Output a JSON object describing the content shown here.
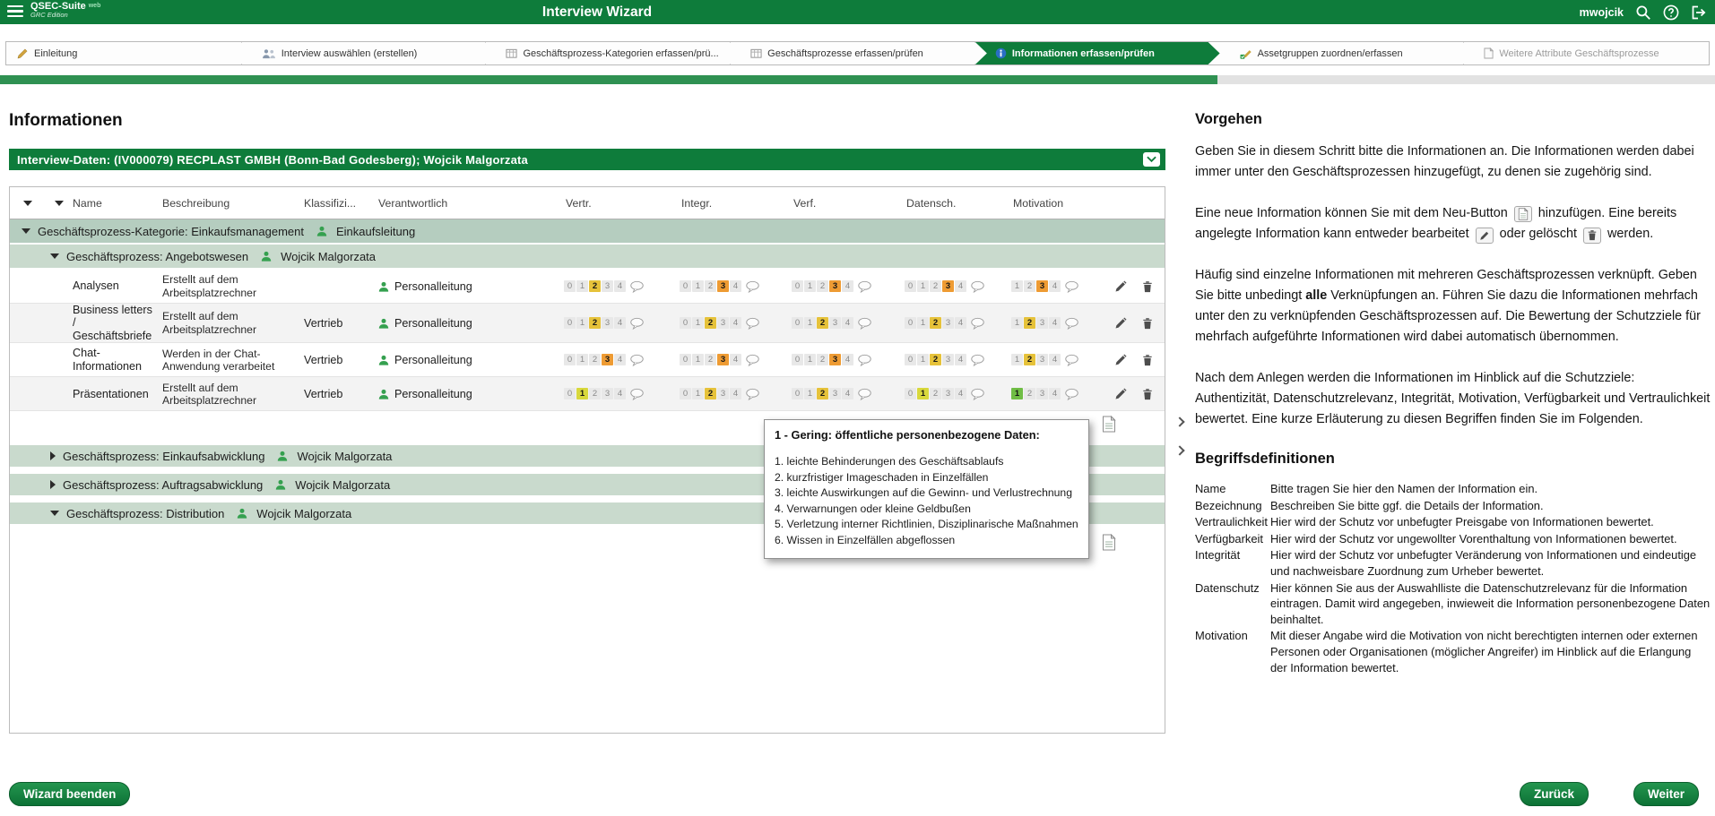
{
  "topbar": {
    "logo_title": "QSEC-Suite",
    "logo_badge": "web",
    "logo_subtitle": "GRC Edition",
    "title": "Interview Wizard",
    "username": "mwojcik"
  },
  "wizard": {
    "steps": [
      {
        "label": "Einleitung"
      },
      {
        "label": "Interview auswählen (erstellen)"
      },
      {
        "label": "Geschäftsprozess-Kategorien erfassen/prü..."
      },
      {
        "label": "Geschäftsprozesse erfassen/prüfen"
      },
      {
        "label": "Informationen erfassen/prüfen"
      },
      {
        "label": "Assetgruppen zuordnen/erfassen"
      },
      {
        "label": "Weitere Attribute Geschäftsprozesse"
      }
    ],
    "progress_percent": 71
  },
  "main": {
    "heading": "Informationen",
    "interview_bar": "Interview-Daten: (IV000079) RECPLAST GMBH (Bonn-Bad Godesberg); Wojcik Malgorzata",
    "columns": [
      "Name",
      "Beschreibung",
      "Klassifizi...",
      "Verantwortlich",
      "Vertr.",
      "Integr.",
      "Verf.",
      "Datensch.",
      "Motivation"
    ],
    "category": {
      "label": "Geschäftsprozess-Kategorie: Einkaufsmanagement",
      "owner": "Einkaufsleitung"
    },
    "process": {
      "label": "Geschäftsprozess: Angebotswesen",
      "owner": "Wojcik Malgorzata"
    },
    "collapsed": [
      {
        "label": "Geschäftsprozess: Einkaufsabwicklung",
        "owner": "Wojcik Malgorzata"
      },
      {
        "label": "Geschäftsprozess: Auftragsabwicklung",
        "owner": "Wojcik Malgorzata"
      },
      {
        "label": "Geschäftsprozess: Distribution",
        "owner": "Wojcik Malgorzata"
      }
    ]
  },
  "rows": [
    {
      "name": "Analysen",
      "beschreibung": "Erstellt auf dem Arbeitsplatzrechner",
      "klassifizierung": "",
      "verantwortlich": "Personalleitung",
      "ratings": {
        "vertr": {
          "min": 0,
          "max": 4,
          "value": 2,
          "color": "#e6c23a"
        },
        "integr": {
          "min": 0,
          "max": 4,
          "value": 3,
          "color": "#ee9b33"
        },
        "verf": {
          "min": 0,
          "max": 4,
          "value": 3,
          "color": "#ee9b33"
        },
        "datensch": {
          "min": 0,
          "max": 4,
          "value": 3,
          "color": "#ee9b33"
        },
        "motivation": {
          "min": 1,
          "max": 4,
          "value": 3,
          "color": "#ee9b33"
        }
      }
    },
    {
      "name": "Business letters / Geschäftsbriefe",
      "beschreibung": "Erstellt auf dem Arbeitsplatzrechner",
      "klassifizierung": "Vertrieb",
      "verantwortlich": "Personalleitung",
      "ratings": {
        "vertr": {
          "min": 0,
          "max": 4,
          "value": 2,
          "color": "#e6c23a"
        },
        "integr": {
          "min": 0,
          "max": 4,
          "value": 2,
          "color": "#e6c23a"
        },
        "verf": {
          "min": 0,
          "max": 4,
          "value": 2,
          "color": "#e6c23a"
        },
        "datensch": {
          "min": 0,
          "max": 4,
          "value": 2,
          "color": "#e6c23a"
        },
        "motivation": {
          "min": 1,
          "max": 4,
          "value": 2,
          "color": "#e6c23a"
        }
      }
    },
    {
      "name": "Chat-Informationen",
      "beschreibung": "Werden in der Chat-Anwendung verarbeitet",
      "klassifizierung": "Vertrieb",
      "verantwortlich": "Personalleitung",
      "ratings": {
        "vertr": {
          "min": 0,
          "max": 4,
          "value": 3,
          "color": "#ee9b33"
        },
        "integr": {
          "min": 0,
          "max": 4,
          "value": 3,
          "color": "#ee9b33"
        },
        "verf": {
          "min": 0,
          "max": 4,
          "value": 3,
          "color": "#ee9b33"
        },
        "datensch": {
          "min": 0,
          "max": 4,
          "value": 2,
          "color": "#e6c23a"
        },
        "motivation": {
          "min": 1,
          "max": 4,
          "value": 2,
          "color": "#e6c23a"
        }
      }
    },
    {
      "name": "Präsentationen",
      "beschreibung": "Erstellt auf dem Arbeitsplatzrechner",
      "klassifizierung": "Vertrieb",
      "verantwortlich": "Personalleitung",
      "ratings": {
        "vertr": {
          "min": 0,
          "max": 4,
          "value": 1,
          "color": "#d8d83c"
        },
        "integr": {
          "min": 0,
          "max": 4,
          "value": 2,
          "color": "#e6c23a"
        },
        "verf": {
          "min": 0,
          "max": 4,
          "value": 2,
          "color": "#e6c23a"
        },
        "datensch": {
          "min": 0,
          "max": 4,
          "value": 1,
          "color": "#d8d83c"
        },
        "motivation": {
          "min": 1,
          "max": 4,
          "value": 1,
          "color": "#70bd45"
        }
      }
    }
  ],
  "tooltip": {
    "title": "1 - Gering: öffentliche personenbezogene Daten:",
    "items": [
      "1. leichte Behinderungen des Geschäftsablaufs",
      "2. kurzfristiger Imageschaden in Einzelfällen",
      "3. leichte Auswirkungen auf die Gewinn- und Verlustrechnung",
      "4. Verwarnungen oder kleine Geldbußen",
      "5. Verletzung interner Richtlinien, Disziplinarische Maßnahmen",
      "6. Wissen in Einzelfällen abgeflossen"
    ]
  },
  "help": {
    "heading": "Vorgehen",
    "p1": "Geben Sie in diesem Schritt bitte die Informationen an. Die Informationen werden dabei immer unter den Geschäftsprozessen hinzugefügt, zu denen sie zugehörig sind.",
    "p2a": "Eine neue Information können Sie mit dem Neu-Button",
    "p2b": "hinzufügen. Eine bereits angelegte Information kann entweder bearbeitet",
    "p2c": "oder gelöscht",
    "p2d": "werden.",
    "p3a": "Häufig sind einzelne Informationen mit mehreren Geschäftsprozessen verknüpft. Geben Sie bitte unbedingt",
    "p3_bold": "alle",
    "p3b": "Verknüpfungen an. Führen Sie dazu die Informationen mehrfach unter den zu verknüpfenden Geschäftsprozessen auf. Die Bewertung der Schutzziele für mehrfach aufgeführte Informationen wird dabei automatisch übernommen.",
    "p4": "Nach dem Anlegen werden die Informationen im Hinblick auf die Schutzziele: Authentizität, Datenschutzrelevanz, Integrität, Motivation, Verfügbarkeit und Vertraulichkeit bewertet. Eine kurze Erläuterung zu diesen Begriffen finden Sie im Folgenden.",
    "defs_heading": "Begriffsdefinitionen",
    "defs": [
      {
        "term": "Name",
        "text": "Bitte tragen Sie hier den Namen der Information ein."
      },
      {
        "term": "Bezeichnung",
        "text": "Beschreiben Sie bitte ggf. die Details der Information."
      },
      {
        "term": "Vertraulichkeit",
        "text": "Hier wird der Schutz vor unbefugter Preisgabe von Informationen bewertet."
      },
      {
        "term": "Verfügbarkeit",
        "text": "Hier wird der Schutz vor ungewollter Vorenthaltung von Informationen bewertet."
      },
      {
        "term": "Integrität",
        "text": "Hier wird der Schutz vor unbefugter Veränderung von Informationen und eindeutige und nachweisbare Zuordnung zum Urheber bewertet."
      },
      {
        "term": "Datenschutz",
        "text": "Hier können Sie aus der Auswahlliste die Datenschutzrelevanz für die Information eintragen. Damit wird angegeben, inwieweit die Information personenbezogene Daten beinhaltet."
      },
      {
        "term": "Motivation",
        "text": "Mit dieser Angabe wird die Motivation von nicht berechtigten internen oder externen Personen oder Organisationen (möglicher Angreifer) im Hinblick auf die Erlangung der Information bewertet."
      }
    ]
  },
  "footer": {
    "finish": "Wizard beenden",
    "back": "Zurück",
    "next": "Weiter"
  }
}
